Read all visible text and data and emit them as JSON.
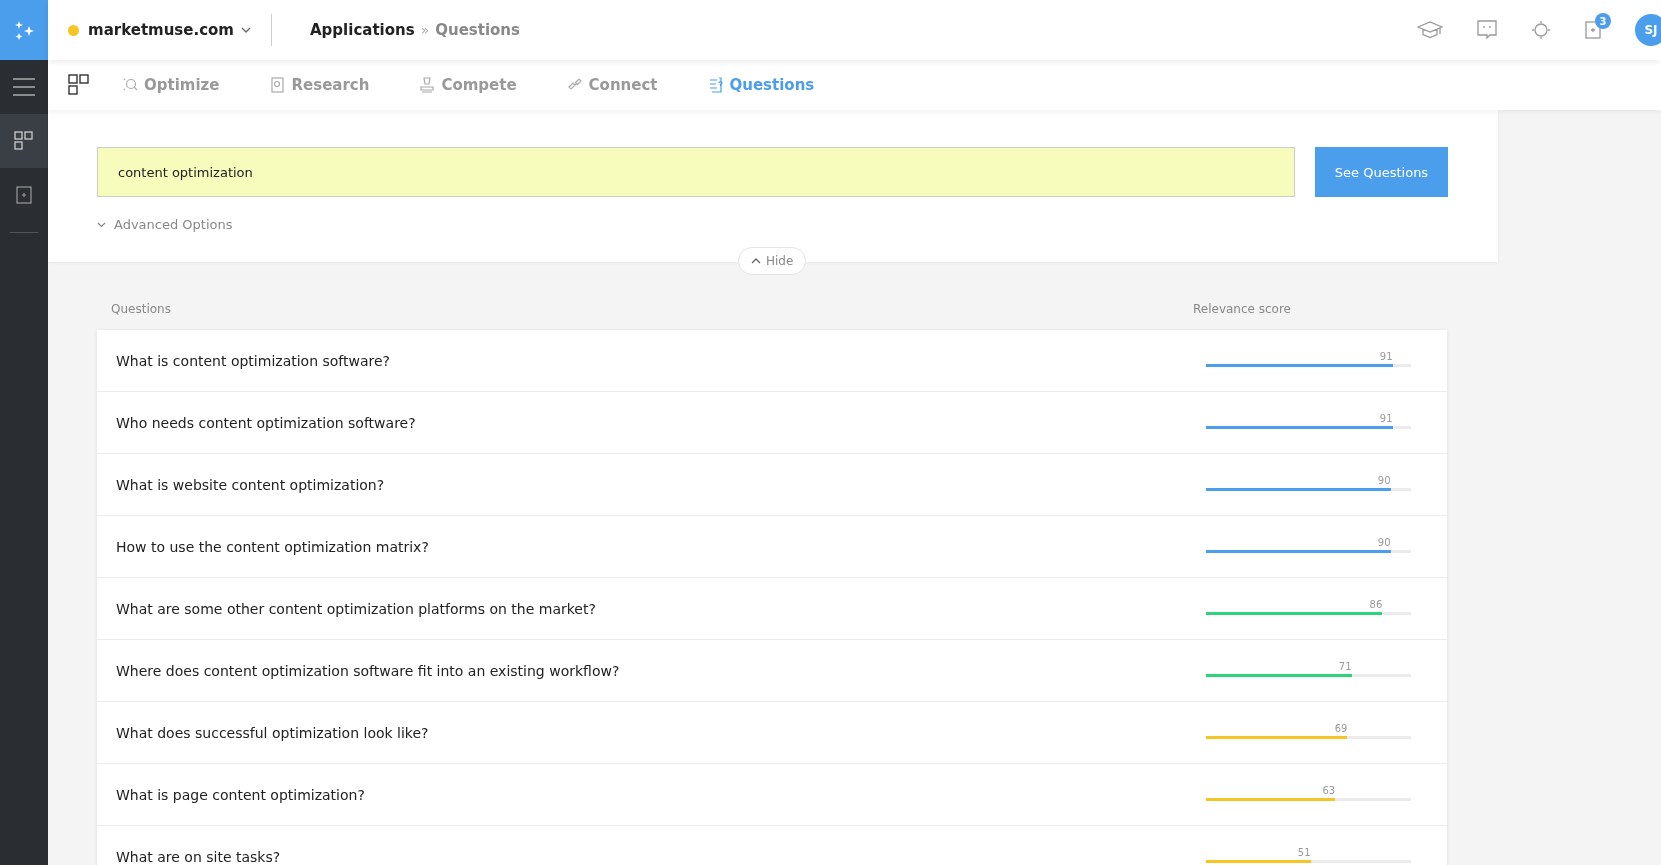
{
  "topbar": {
    "site": "marketmuse.com",
    "breadcrumb": [
      "Applications",
      "Questions"
    ],
    "breadcrumb_separator": "»",
    "notification_count": "3",
    "avatar": "SJ"
  },
  "nav_tabs": [
    {
      "label": "Optimize",
      "selected": false
    },
    {
      "label": "Research",
      "selected": false
    },
    {
      "label": "Compete",
      "selected": false
    },
    {
      "label": "Connect",
      "selected": false
    },
    {
      "label": "Questions",
      "selected": true
    }
  ],
  "search": {
    "value": "content optimization",
    "button": "See Questions",
    "advanced": "Advanced Options",
    "hide": "Hide"
  },
  "table": {
    "columns": [
      "Questions",
      "Relevance score"
    ],
    "rows": [
      {
        "question": "What is content optimization software?",
        "score": "91",
        "level": 0.91,
        "color": "#4a9eeb"
      },
      {
        "question": "Who needs content optimization software?",
        "score": "91",
        "level": 0.91,
        "color": "#4a9eeb"
      },
      {
        "question": "What is website content optimization?",
        "score": "90",
        "level": 0.9,
        "color": "#4a9eeb"
      },
      {
        "question": "How to use the content optimization matrix?",
        "score": "90",
        "level": 0.9,
        "color": "#4a9eeb"
      },
      {
        "question": "What are some other content optimization platforms on the market?",
        "score": "86",
        "level": 0.86,
        "color": "#2ed47a"
      },
      {
        "question": "Where does content optimization software fit into an existing workflow?",
        "score": "71",
        "level": 0.71,
        "color": "#2ed47a"
      },
      {
        "question": "What does successful optimization look like?",
        "score": "69",
        "level": 0.69,
        "color": "#f5c623"
      },
      {
        "question": "What is page content optimization?",
        "score": "63",
        "level": 0.63,
        "color": "#f5c623"
      },
      {
        "question": "What are on site tasks?",
        "score": "51",
        "level": 0.51,
        "color": "#f5c623"
      }
    ]
  }
}
